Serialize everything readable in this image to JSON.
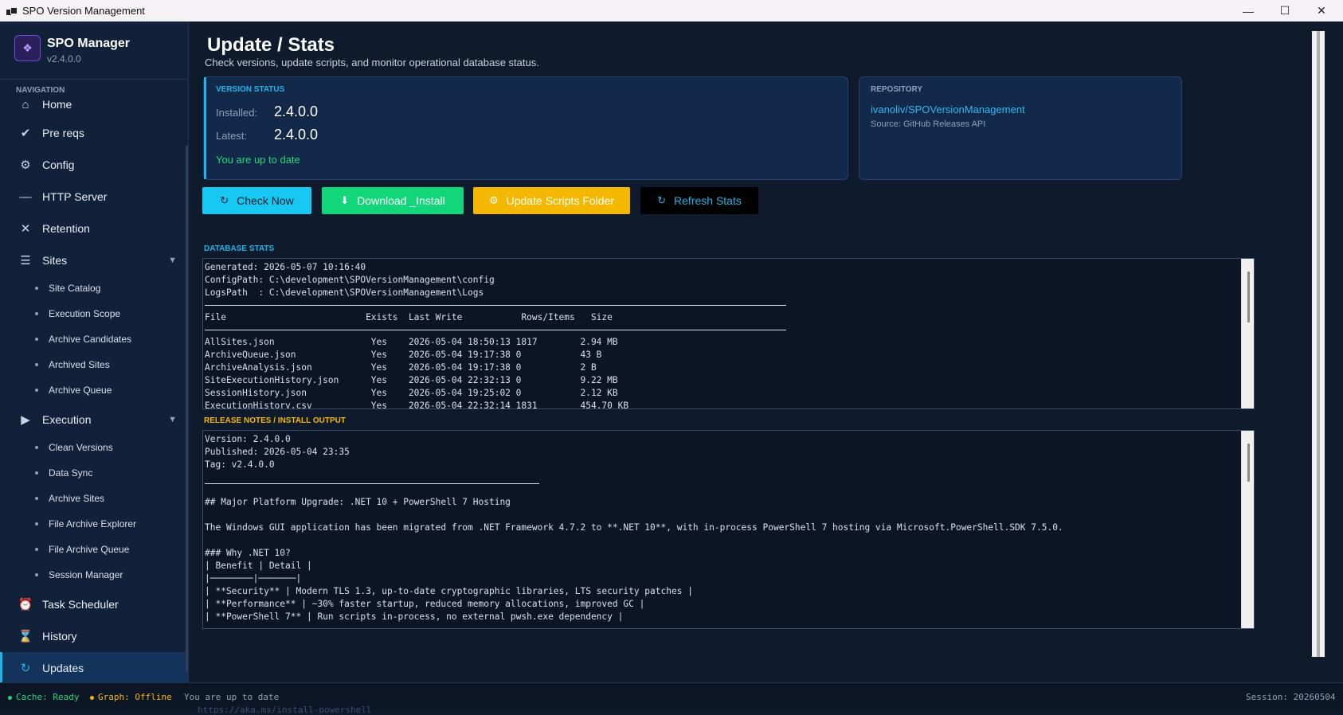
{
  "window": {
    "title": "SPO Version Management"
  },
  "brand": {
    "name": "SPO Manager",
    "version": "v2.4.0.0"
  },
  "nav_label": "NAVIGATION",
  "nav": {
    "home": "Home",
    "prereqs": "Pre reqs",
    "config": "Config",
    "http_server": "HTTP Server",
    "retention": "Retention",
    "sites": "Sites",
    "execution": "Execution",
    "task_scheduler": "Task Scheduler",
    "history": "History",
    "updates": "Updates"
  },
  "sites_sub": [
    "Site Catalog",
    "Execution Scope",
    "Archive Candidates",
    "Archived Sites",
    "Archive Queue"
  ],
  "execution_sub": [
    "Clean Versions",
    "Data Sync",
    "Archive Sites",
    "File Archive Explorer",
    "File Archive Queue",
    "Session Manager"
  ],
  "page": {
    "title": "Update / Stats",
    "subtitle": "Check versions, update scripts, and monitor operational database status."
  },
  "version_status": {
    "label": "VERSION STATUS",
    "installed_label": "Installed:",
    "installed_value": "2.4.0.0",
    "latest_label": "Latest:",
    "latest_value": "2.4.0.0",
    "status": "You are up to date"
  },
  "repository": {
    "label": "REPOSITORY",
    "link": "ivanoliv/SPOVersionManagement",
    "source": "Source: GitHub Releases API"
  },
  "buttons": {
    "check_now": "Check Now",
    "download_install": "Download _Install",
    "update_scripts": "Update Scripts Folder",
    "refresh_stats": "Refresh Stats"
  },
  "colors": {
    "accent": "#1fb4e8",
    "success": "#22d67a",
    "warning": "#f5b800",
    "brand": "#6d4bd8"
  },
  "db_stats": {
    "label": "DATABASE STATS",
    "header": "Generated: 2026-05-07 10:16:40\nConfigPath: C:\\development\\SPOVersionManagement\\config\nLogsPath  : C:\\development\\SPOVersionManagement\\Logs",
    "columns": "File                          Exists  Last Write           Rows/Items   Size",
    "rows": "AllSites.json                  Yes    2026-05-04 18:50:13 1817        2.94 MB\nArchiveQueue.json              Yes    2026-05-04 19:17:38 0           43 B\nArchiveAnalysis.json           Yes    2026-05-04 19:17:38 0           2 B\nSiteExecutionHistory.json      Yes    2026-05-04 22:32:13 0           9.22 MB\nSessionHistory.json            Yes    2026-05-04 19:25:02 0           2.12 KB\nExecutionHistory.csv           Yes    2026-05-04 22:32:14 1831        454.70 KB"
  },
  "release_notes": {
    "label": "RELEASE NOTES / INSTALL OUTPUT",
    "header": "Version: 2.4.0.0\nPublished: 2026-05-04 23:35\nTag: v2.4.0.0",
    "body": "## Major Platform Upgrade: .NET 10 + PowerShell 7 Hosting\n\nThe Windows GUI application has been migrated from .NET Framework 4.7.2 to **.NET 10**, with in-process PowerShell 7 hosting via Microsoft.PowerShell.SDK 7.5.0.\n\n### Why .NET 10?\n| Benefit | Detail |\n|────────|───────|\n| **Security** | Modern TLS 1.3, up-to-date cryptographic libraries, LTS security patches |\n| **Performance** | ~30% faster startup, reduced memory allocations, improved GC |\n| **PowerShell 7** | Run scripts in-process, no external pwsh.exe dependency |"
  },
  "statusbar": {
    "cache": "Cache: Ready",
    "graph": "Graph: Offline",
    "message": "You are up to date",
    "session": "Session: 20260504",
    "overflow": "https://aka.ms/install-powershell"
  }
}
